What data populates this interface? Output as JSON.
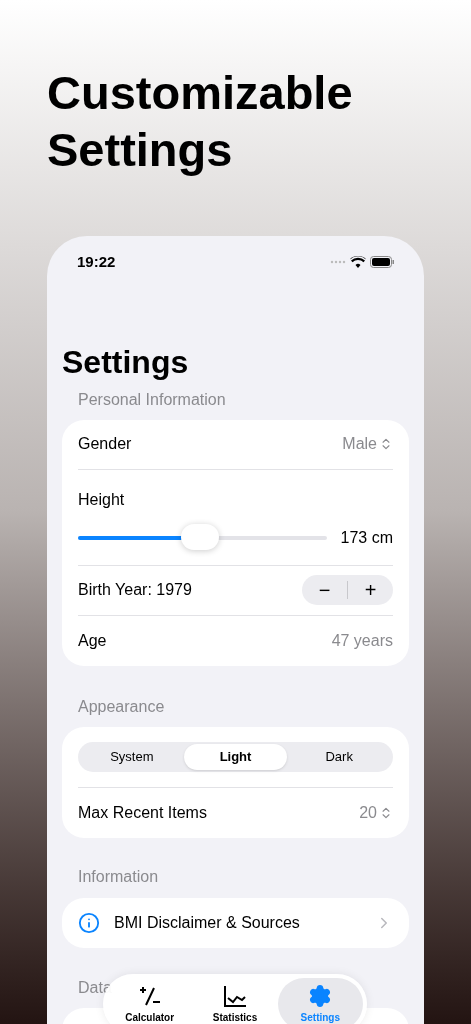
{
  "headline": "Customizable Settings",
  "status_bar": {
    "time": "19:22"
  },
  "title": "Settings",
  "personal": {
    "header": "Personal Information",
    "gender": {
      "label": "Gender",
      "value": "Male"
    },
    "height": {
      "label": "Height",
      "level": 0.49,
      "reading": "173 cm"
    },
    "birth_year": {
      "label": "Birth Year: 1979",
      "minus": "−",
      "plus": "+"
    },
    "age": {
      "label": "Age",
      "value": "47 years"
    }
  },
  "appearance": {
    "header": "Appearance",
    "segments": [
      {
        "label": "System",
        "selected": false
      },
      {
        "label": "Light",
        "selected": true
      },
      {
        "label": "Dark",
        "selected": false
      }
    ],
    "max_recent": {
      "label": "Max Recent Items",
      "value": "20"
    }
  },
  "information": {
    "header": "Information",
    "item": "BMI Disclaimer & Sources"
  },
  "data_header": "Data",
  "tab_bar": [
    {
      "label": "Calculator",
      "kind": "calculator",
      "selected": false
    },
    {
      "label": "Statistics",
      "kind": "chart",
      "selected": false
    },
    {
      "label": "Settings",
      "kind": "gear",
      "selected": true
    }
  ]
}
